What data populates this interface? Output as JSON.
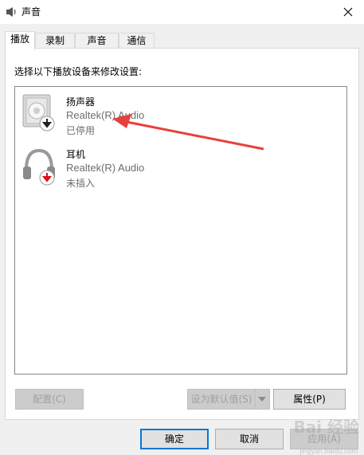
{
  "window": {
    "title": "声音",
    "close_icon": "close-icon"
  },
  "tabs": [
    {
      "label": "播放",
      "active": true
    },
    {
      "label": "录制",
      "active": false
    },
    {
      "label": "声音",
      "active": false
    },
    {
      "label": "通信",
      "active": false
    }
  ],
  "panel": {
    "instruction": "选择以下播放设备来修改设置:"
  },
  "devices": [
    {
      "name": "扬声器",
      "driver": "Realtek(R) Audio",
      "status": "已停用",
      "icon": "speaker-icon",
      "badge": "disabled-badge-icon"
    },
    {
      "name": "耳机",
      "driver": "Realtek(R) Audio",
      "status": "未插入",
      "icon": "headphones-icon",
      "badge": "unplugged-badge-icon"
    }
  ],
  "buttons": {
    "configure": "配置(C)",
    "set_default": "设为默认值(S)",
    "properties": "属性(P)",
    "ok": "确定",
    "cancel": "取消",
    "apply": "应用(A)"
  },
  "watermark": {
    "logo": "Bai 经验",
    "site": "jingyan.baidu.com"
  },
  "colors": {
    "accent": "#0078d7",
    "annotation_arrow": "#e8403a"
  }
}
